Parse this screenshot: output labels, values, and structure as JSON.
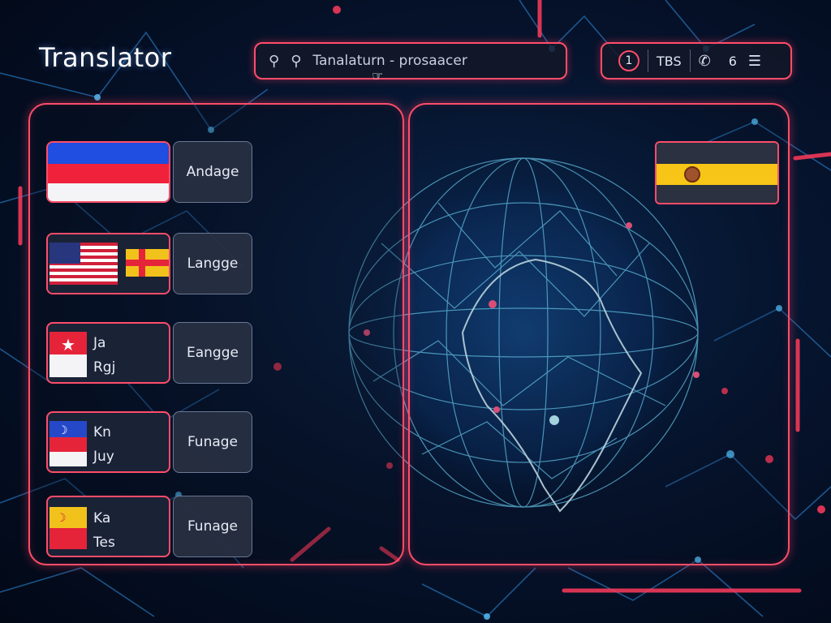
{
  "app": {
    "title": "Translator"
  },
  "search": {
    "icon": "search-icon",
    "icon2": "search-icon",
    "text": "Tanalaturn - prosaacer"
  },
  "topbar": {
    "badge": "1",
    "label": "TBS",
    "phone_icon": "phone-icon",
    "number": "6",
    "menu_icon": "menu-icon"
  },
  "languages": [
    {
      "flag": "blue-red-white-flag",
      "label": "Andage",
      "texts": []
    },
    {
      "flag": "us-flag-and-yellow-red-cross-flag",
      "label": "Langge",
      "texts": []
    },
    {
      "flag": "red-star-flag",
      "label": "Eangge",
      "texts": [
        "Ja",
        "Rgj"
      ]
    },
    {
      "flag": "crescent-blue-red-flag",
      "label": "Funage",
      "texts": [
        "Kn",
        "Juy"
      ]
    },
    {
      "flag": "crescent-yellow-red-flag",
      "label": "Funage",
      "texts": [
        "Ka",
        "Tes"
      ]
    }
  ],
  "target": {
    "flag": "yellow-black-emblem-flag"
  },
  "colors": {
    "accent": "#ff4d6a",
    "network": "#3fb6ff",
    "background": "#06142e"
  }
}
